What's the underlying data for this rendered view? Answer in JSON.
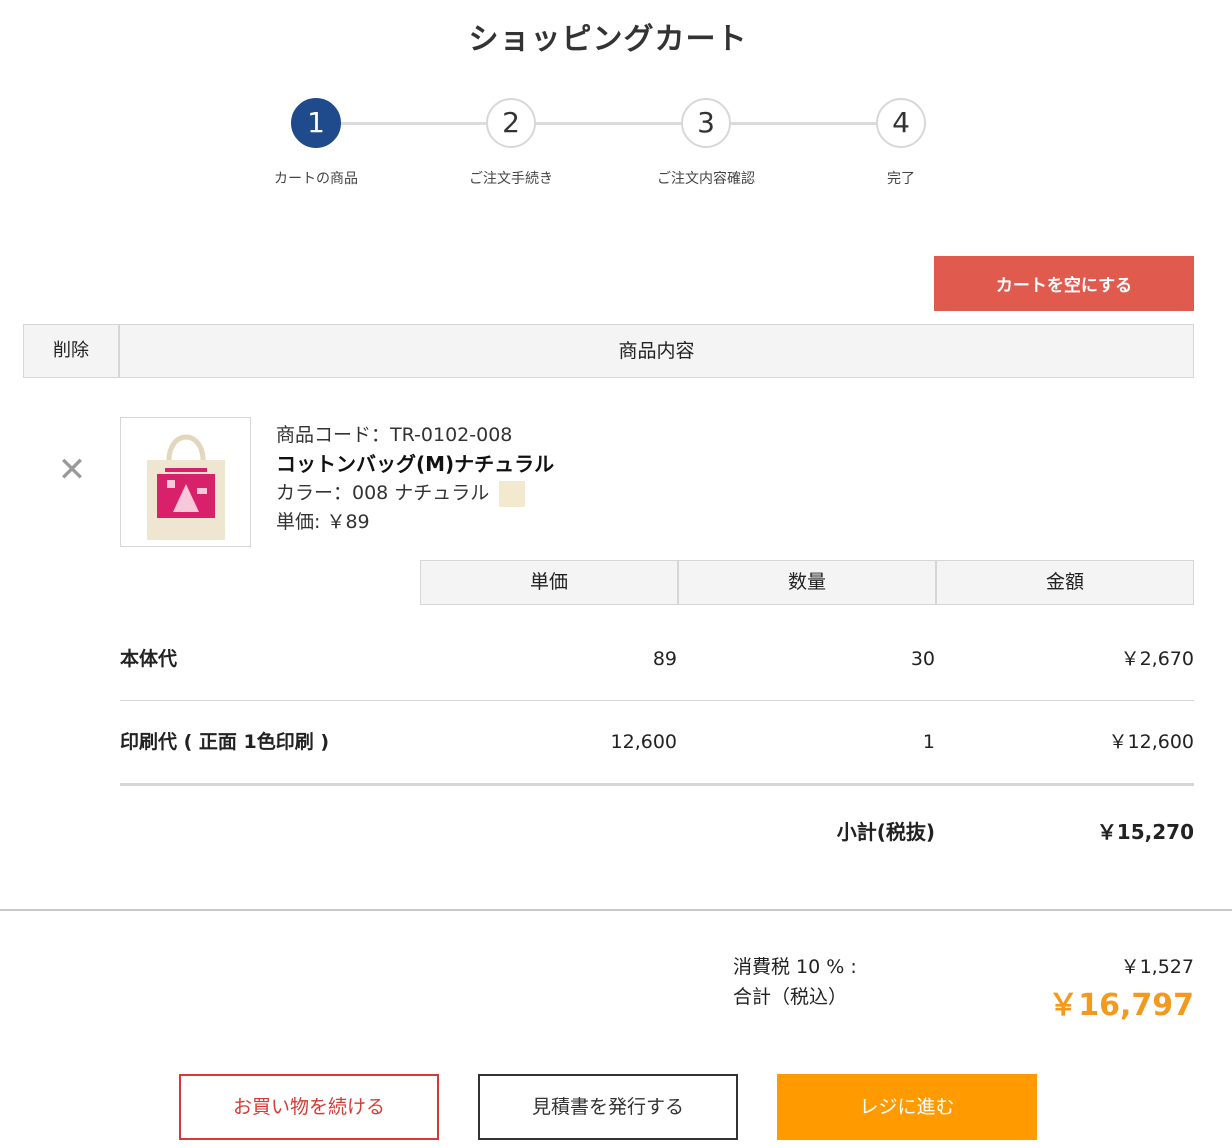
{
  "page": {
    "title": "ショッピングカート"
  },
  "steps": [
    {
      "number": "1",
      "label": "カートの商品"
    },
    {
      "number": "2",
      "label": "ご注文手続き"
    },
    {
      "number": "3",
      "label": "ご注文内容確認"
    },
    {
      "number": "4",
      "label": "完了"
    }
  ],
  "actions": {
    "clear_cart": "カートを空にする"
  },
  "table_header": {
    "delete": "削除",
    "content": "商品内容"
  },
  "product": {
    "code": "商品コード：TR-0102-008",
    "name": "コットンバッグ(M)ナチュラル",
    "color": "カラー：008 ナチュラル",
    "color_swatch": "#f3e9cf",
    "unit_price": "単価: ￥89",
    "image_colors": {
      "bag": "#efe6d2",
      "print": "#d9206b"
    }
  },
  "price_table": {
    "headers": [
      "単価",
      "数量",
      "金額"
    ],
    "rows": [
      {
        "label": "本体代",
        "unit": "89",
        "qty": "30",
        "amount": "￥2,670"
      },
      {
        "label": "印刷代 ( 正面 1色印刷 )",
        "unit": "12,600",
        "qty": "1",
        "amount": "￥12,600"
      }
    ],
    "subtotal_label": "小計(税抜)",
    "subtotal_value": "￥15,270"
  },
  "totals": {
    "tax_label": "消費税 10 % :",
    "tax_value": "￥1,527",
    "total_label": "合計（税込）",
    "total_value": "￥16,797",
    "accent_color": "#f39a1e"
  },
  "buttons": {
    "continue": "お買い物を続ける",
    "quote": "見積書を発行する",
    "checkout": "レジに進む"
  }
}
